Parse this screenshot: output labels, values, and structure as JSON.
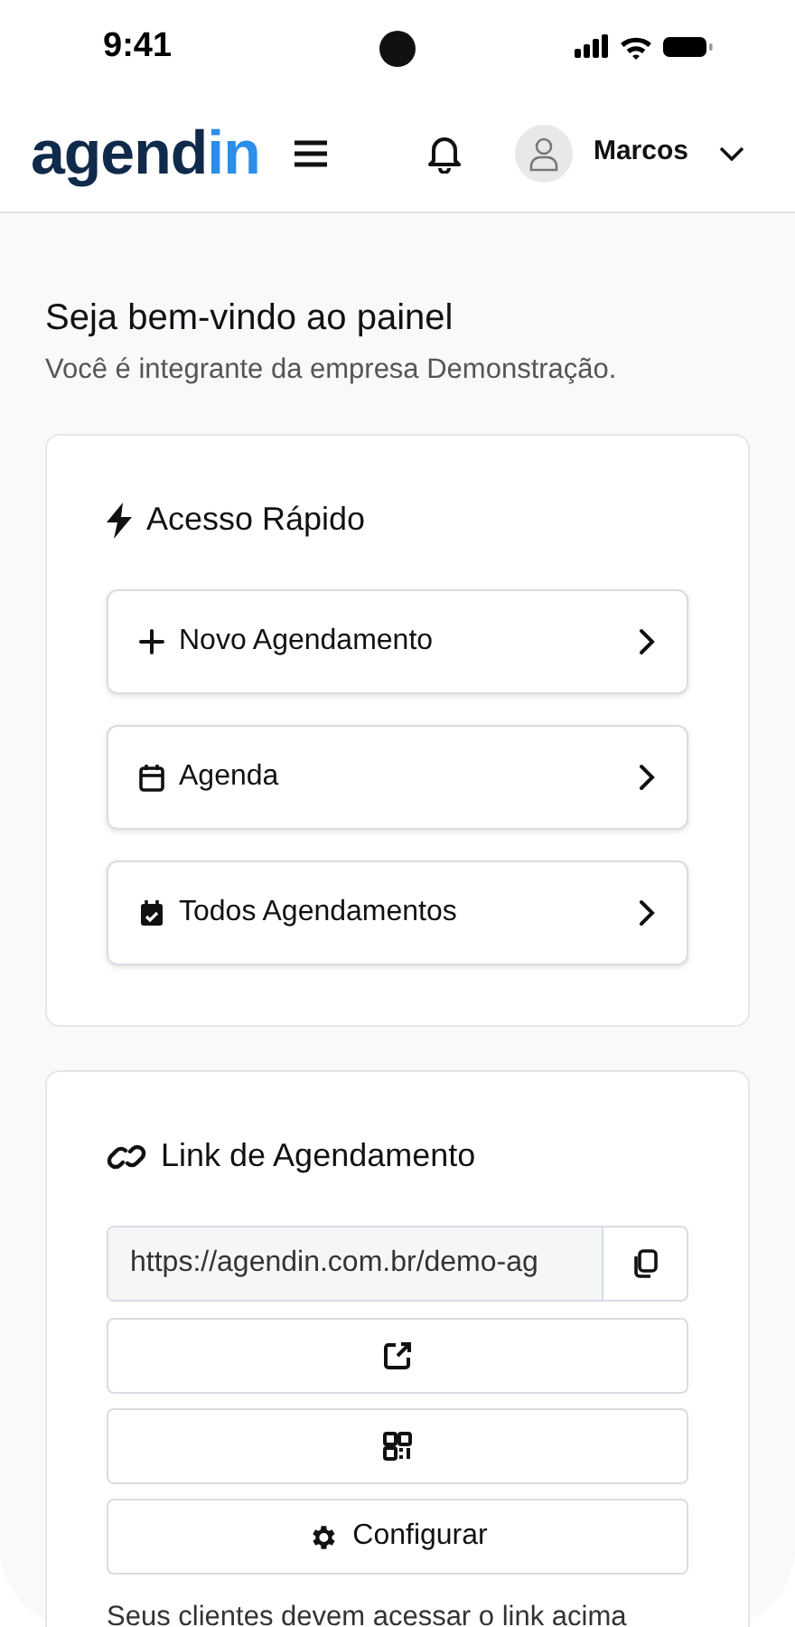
{
  "status_bar": {
    "time": "9:41"
  },
  "header": {
    "logo": {
      "dark": "agend",
      "accent": "in"
    },
    "user_name": "Marcos"
  },
  "welcome": {
    "title": "Seja bem-vindo ao painel",
    "subtitle": "Você é integrante da empresa Demonstração."
  },
  "quick_access": {
    "title": "Acesso Rápido",
    "items": [
      {
        "kind": "plus",
        "label": "Novo Agendamento"
      },
      {
        "kind": "calendar",
        "label": "Agenda"
      },
      {
        "kind": "calendar-check",
        "label": "Todos Agendamentos"
      }
    ]
  },
  "booking_link": {
    "title": "Link de Agendamento",
    "url": "https://agendin.com.br/demo-ag",
    "buttons": [
      {
        "kind": "open"
      },
      {
        "kind": "qr"
      },
      {
        "kind": "settings",
        "label": "Configurar"
      }
    ],
    "note": "Seus clientes devem acessar o link acima"
  }
}
